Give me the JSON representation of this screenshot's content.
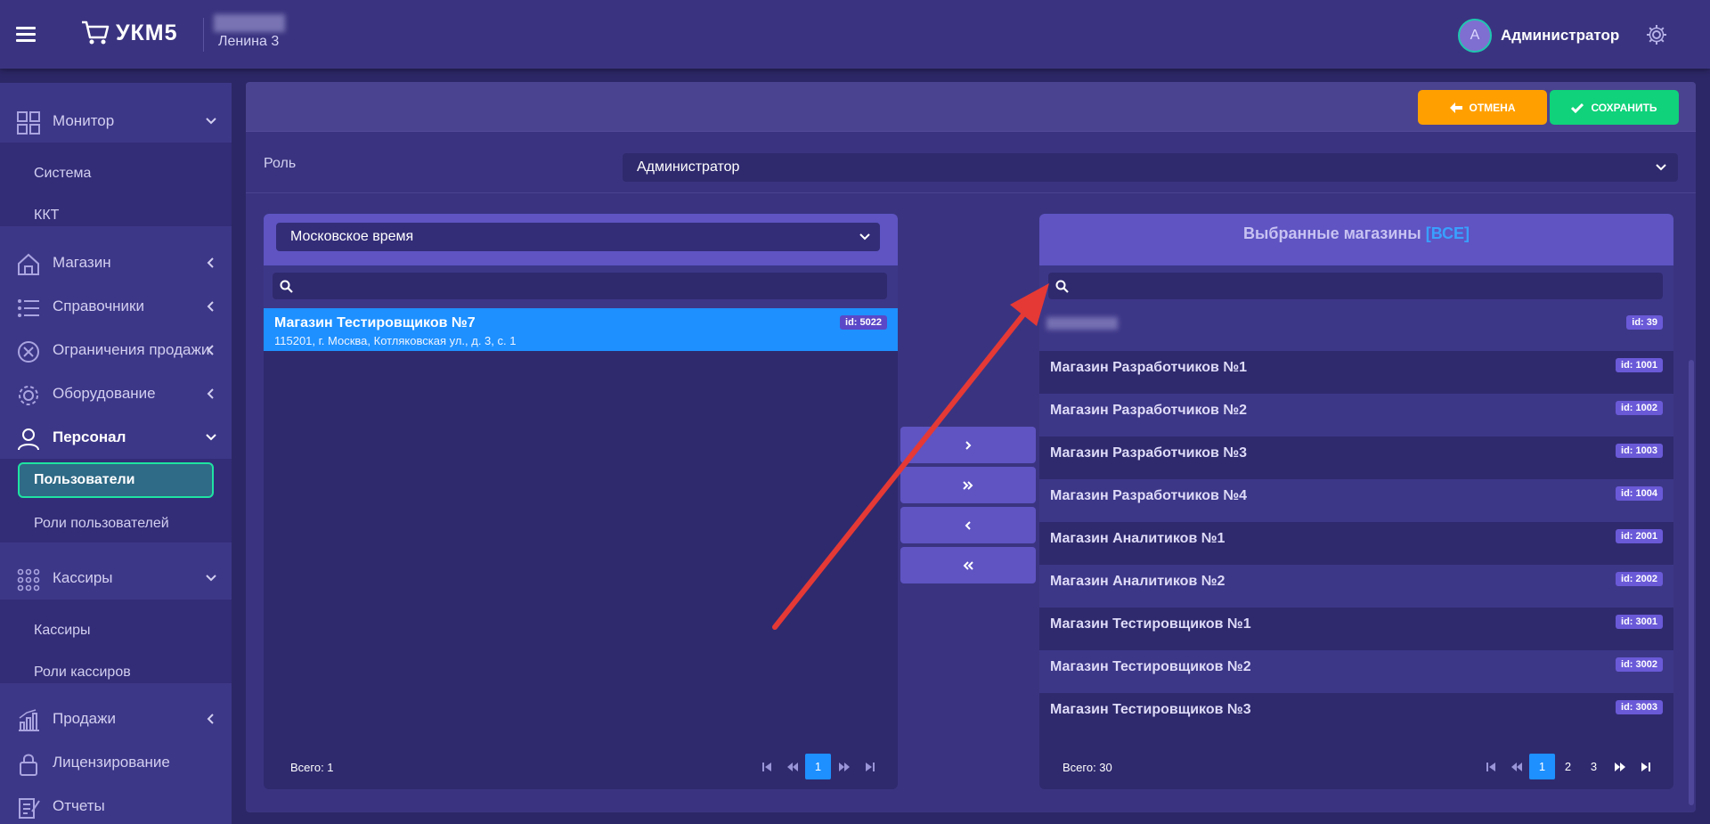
{
  "header": {
    "brand": "УКМ5",
    "store_name": "Ленина 3",
    "user_initial": "А",
    "user_name": "Администратор"
  },
  "sidebar": {
    "items": [
      {
        "label": "Монитор",
        "icon": "monitor-icon"
      },
      {
        "label": "Магазин",
        "icon": "store-icon"
      },
      {
        "label": "Справочники",
        "icon": "list-icon"
      },
      {
        "label": "Ограничения продажи",
        "icon": "restrict-icon"
      },
      {
        "label": "Оборудование",
        "icon": "equipment-icon"
      },
      {
        "label": "Персонал",
        "icon": "person-icon"
      },
      {
        "label": "Кассиры",
        "icon": "cashiers-icon"
      },
      {
        "label": "Продажи",
        "icon": "sales-icon"
      },
      {
        "label": "Лицензирование",
        "icon": "license-icon"
      },
      {
        "label": "Отчеты",
        "icon": "reports-icon"
      }
    ],
    "monitor_sub": [
      "Система",
      "ККТ"
    ],
    "personal_sub": [
      "Пользователи",
      "Роли пользователей"
    ],
    "cashiers_sub": [
      "Кассиры",
      "Роли кассиров"
    ]
  },
  "toolbar": {
    "cancel_label": "ОТМЕНА",
    "save_label": "СОХРАНИТЬ"
  },
  "role": {
    "label": "Роль",
    "value": "Администратор"
  },
  "left_panel": {
    "timezone": "Московское время",
    "search_placeholder": "",
    "stores": [
      {
        "name": "Магазин Тестировщиков №7",
        "address": "115201, г. Москва, Котляковская ул., д. 3, с. 1",
        "id": "id: 5022"
      }
    ],
    "total": "Всего: 1",
    "pages": [
      "1"
    ]
  },
  "right_panel": {
    "title": "Выбранные магазины",
    "title_all": "[ВСЕ]",
    "search_placeholder": "",
    "stores": [
      {
        "name": "",
        "id": "id: 39"
      },
      {
        "name": "Магазин Разработчиков №1",
        "id": "id: 1001"
      },
      {
        "name": "Магазин Разработчиков №2",
        "id": "id: 1002"
      },
      {
        "name": "Магазин Разработчиков №3",
        "id": "id: 1003"
      },
      {
        "name": "Магазин Разработчиков №4",
        "id": "id: 1004"
      },
      {
        "name": "Магазин Аналитиков №1",
        "id": "id: 2001"
      },
      {
        "name": "Магазин Аналитиков №2",
        "id": "id: 2002"
      },
      {
        "name": "Магазин Тестировщиков №1",
        "id": "id: 3001"
      },
      {
        "name": "Магазин Тестировщиков №2",
        "id": "id: 3002"
      },
      {
        "name": "Магазин Тестировщиков №3",
        "id": "id: 3003"
      }
    ],
    "total": "Всего: 30",
    "pages": [
      "1",
      "2",
      "3"
    ]
  },
  "transfer": {
    "move_one": "›",
    "move_all": "»",
    "remove_one": "‹",
    "remove_all": "«"
  },
  "colors": {
    "accent": "#1e90ff",
    "cancel": "#ffa000",
    "save": "#10d27a",
    "annotation_arrow": "#e53935"
  }
}
